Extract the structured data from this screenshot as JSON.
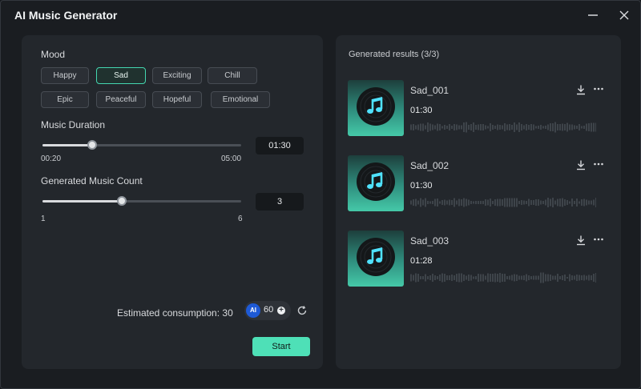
{
  "window": {
    "title": "AI Music Generator"
  },
  "mood": {
    "label": "Mood",
    "options": [
      "Happy",
      "Sad",
      "Exciting",
      "Chill",
      "Epic",
      "Peaceful",
      "Hopeful",
      "Emotional"
    ],
    "selected": "Sad"
  },
  "duration": {
    "label": "Music Duration",
    "min_label": "00:20",
    "max_label": "05:00",
    "value_label": "01:30",
    "min_seconds": 20,
    "max_seconds": 300,
    "value_seconds": 90
  },
  "count": {
    "label": "Generated Music Count",
    "min_label": "1",
    "max_label": "6",
    "value_label": "3",
    "min": 1,
    "max": 6,
    "value": 3
  },
  "consumption": {
    "label": "Estimated consumption: 30",
    "badge": "AI",
    "credits": "60"
  },
  "actions": {
    "start_label": "Start"
  },
  "results": {
    "title": "Generated results (3/3)",
    "items": [
      {
        "name": "Sad_001",
        "duration": "01:30"
      },
      {
        "name": "Sad_002",
        "duration": "01:30"
      },
      {
        "name": "Sad_003",
        "duration": "01:28"
      }
    ]
  },
  "colors": {
    "accent": "#4ee0b7",
    "selected_border": "#44d6b0",
    "panel": "#23272c",
    "window": "#1a1d21"
  },
  "icons": {
    "minimize": "minimize-icon",
    "close": "close-icon",
    "refresh": "refresh-icon",
    "download": "download-icon",
    "more": "more-icon",
    "cover": "music-note-icon"
  }
}
